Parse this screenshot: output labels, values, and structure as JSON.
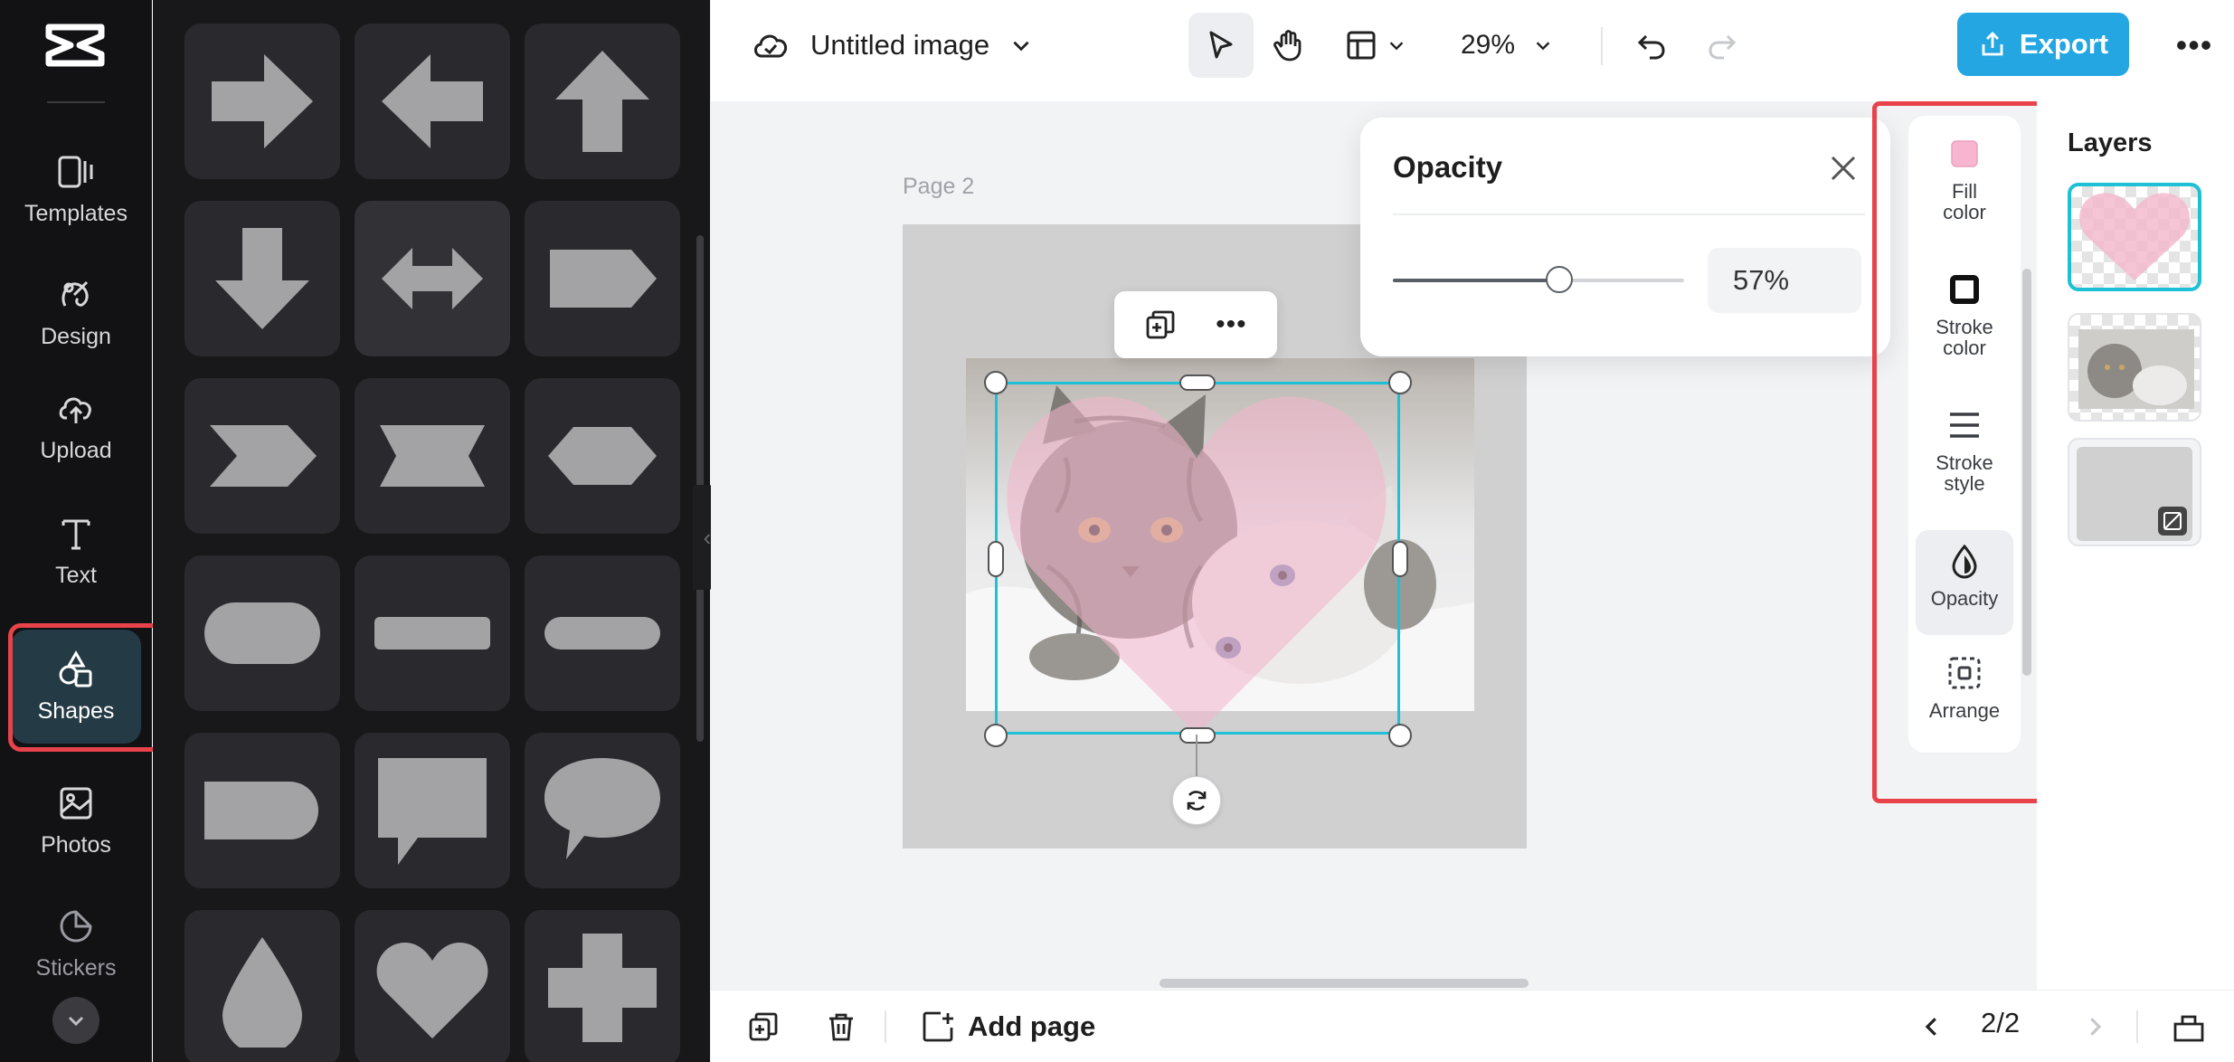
{
  "rail": {
    "items": [
      {
        "name": "templates",
        "label": "Templates",
        "icon": "templates-icon"
      },
      {
        "name": "design",
        "label": "Design",
        "icon": "design-icon"
      },
      {
        "name": "upload",
        "label": "Upload",
        "icon": "upload-icon"
      },
      {
        "name": "text",
        "label": "Text",
        "icon": "text-icon"
      },
      {
        "name": "shapes",
        "label": "Shapes",
        "icon": "shapes-icon",
        "active": true
      },
      {
        "name": "photos",
        "label": "Photos",
        "icon": "photos-icon"
      },
      {
        "name": "stickers",
        "label": "Stickers",
        "icon": "stickers-icon"
      }
    ]
  },
  "shapes_panel": {
    "shapes": [
      "arrow-right",
      "arrow-left",
      "arrow-up",
      "arrow-down",
      "arrow-left-right",
      "pentagon-arrow",
      "chevron",
      "ribbon",
      "hexagon-flat",
      "rounded-pill",
      "rectangle",
      "rounded-bar",
      "rounded-tab",
      "speech-rectangle",
      "speech-oval",
      "drop",
      "heart",
      "cross"
    ]
  },
  "topbar": {
    "doc_title": "Untitled image",
    "zoom": "29%",
    "export_label": "Export"
  },
  "canvas": {
    "page_label": "Page 2",
    "heart_color": "#f3b6cc",
    "selection_color": "#1ec0d6"
  },
  "opacity_panel": {
    "title": "Opacity",
    "value": 57,
    "value_text": "57%"
  },
  "props": {
    "items": [
      {
        "name": "fill-color",
        "label_1": "Fill",
        "label_2": "color",
        "swatch": "#f8b5cf"
      },
      {
        "name": "stroke-color",
        "label_1": "Stroke",
        "label_2": "color"
      },
      {
        "name": "stroke-style",
        "label_1": "Stroke",
        "label_2": "style"
      },
      {
        "name": "opacity",
        "label_1": "Opacity",
        "label_2": "",
        "active": true
      },
      {
        "name": "arrange",
        "label_1": "Arrange",
        "label_2": ""
      }
    ]
  },
  "layers": {
    "title": "Layers"
  },
  "bottombar": {
    "add_page_label": "Add page",
    "pager": "2/2"
  },
  "colors": {
    "accent": "#24a6e3",
    "highlight": "#e8434a"
  }
}
